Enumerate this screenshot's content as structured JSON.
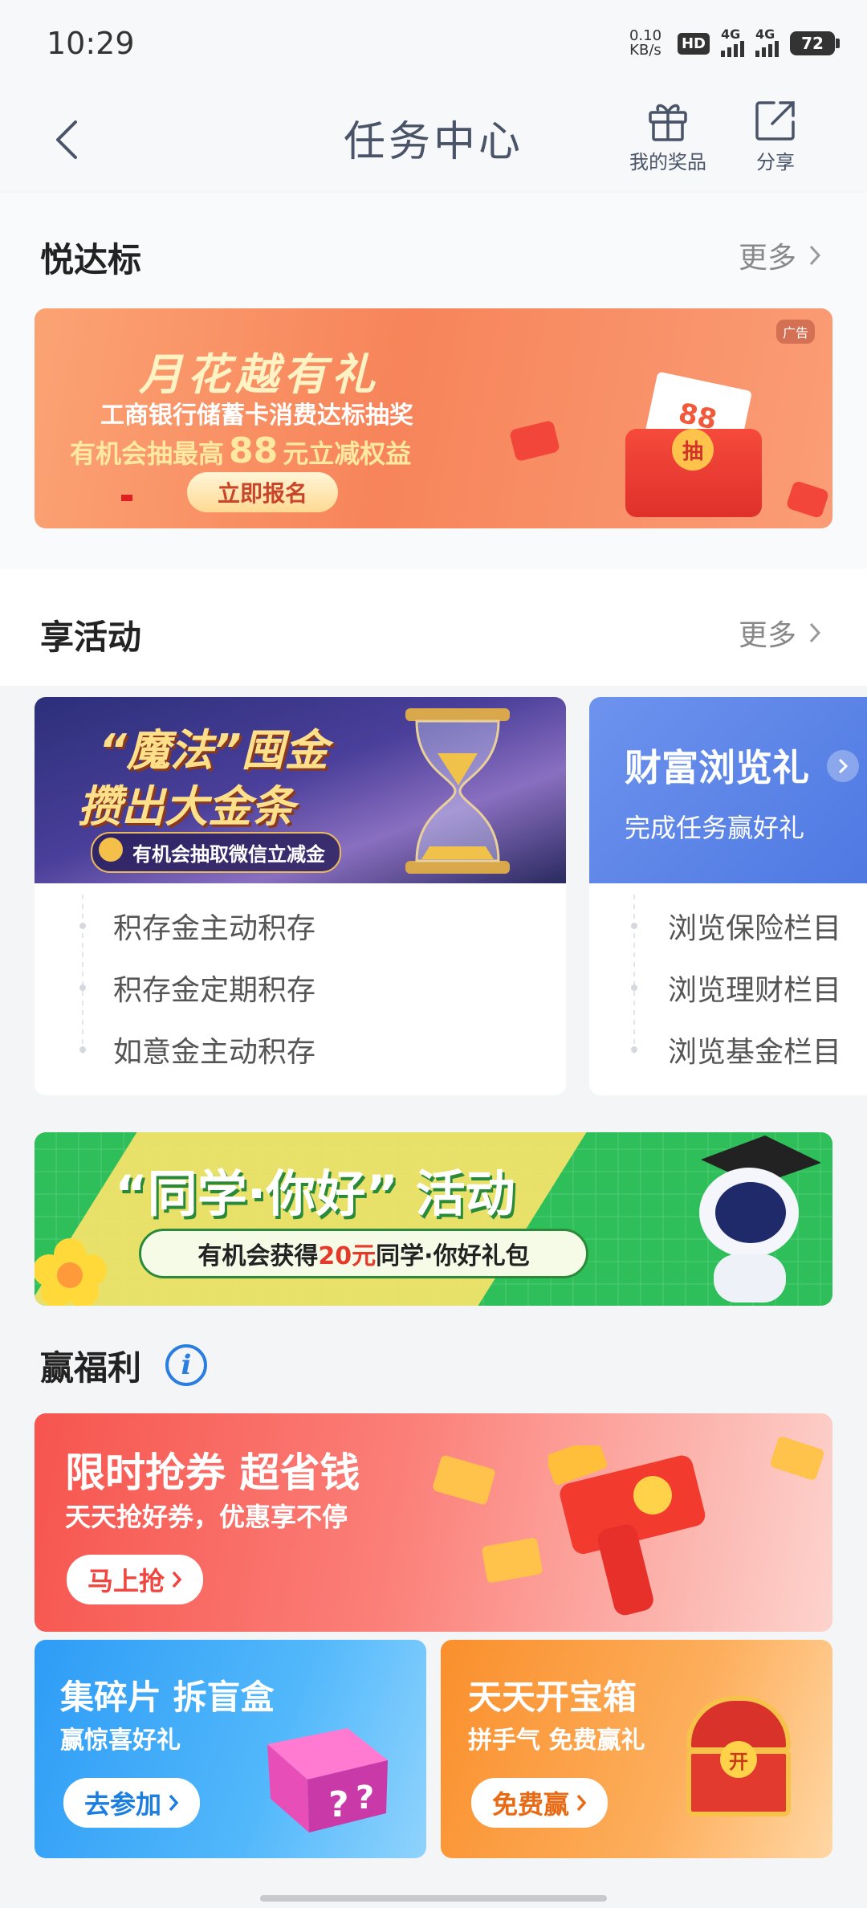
{
  "status": {
    "time": "10:29",
    "net_speed_value": "0.10",
    "net_speed_unit": "KB/s",
    "hd": "HD",
    "net1": "4G",
    "net2": "4G",
    "battery": "72"
  },
  "header": {
    "title": "任务中心",
    "my_prizes": "我的奖品",
    "share": "分享"
  },
  "section_yue": {
    "title": "悦达标",
    "more": "更多",
    "banner": {
      "badge": "广告",
      "headline": "月花越有礼",
      "line1": "工商银行储蓄卡消费达标抽奖",
      "line2_pre": "有机会抽最高",
      "line2_num": "88",
      "line2_post": "元立减权益",
      "button": "立即报名",
      "coupon_num": "88",
      "coupon_char": "抽"
    }
  },
  "section_xiang": {
    "title": "享活动",
    "more": "更多",
    "card1": {
      "headline1": "“魔法”囤金",
      "headline2": "攒出大金条",
      "sub": "有机会抽取微信立减金",
      "tasks": [
        "积存金主动积存",
        "积存金定期积存",
        "如意金主动积存"
      ]
    },
    "card2": {
      "title": "财富浏览礼",
      "subtitle": "完成任务赢好礼",
      "tasks": [
        "浏览保险栏目",
        "浏览理财栏目",
        "浏览基金栏目"
      ]
    }
  },
  "student_banner": {
    "headline": "“同学·你好” 活动",
    "sub_pre": "有机会获得",
    "sub_amount": "20元",
    "sub_post": "同学·你好礼包"
  },
  "section_ying": {
    "title": "赢福利",
    "info_icon": "i",
    "coupon": {
      "title": "限时抢券 超省钱",
      "subtitle": "天天抢好券，优惠享不停",
      "button": "马上抢"
    },
    "blindbox": {
      "title": "集碎片 拆盲盒",
      "subtitle": "赢惊喜好礼",
      "button": "去参加"
    },
    "treasure": {
      "title": "天天开宝箱",
      "subtitle": "拼手气 免费赢礼",
      "button": "免费赢",
      "chest_char": "开"
    }
  },
  "colors": {
    "orange_banner": "#f7845a",
    "blue_card": "#5f86e8",
    "green_banner": "#2fbf5a",
    "red_coupon": "#f4514f",
    "sky_blue": "#36a9f7",
    "orange_treasure": "#fb9a3a"
  }
}
